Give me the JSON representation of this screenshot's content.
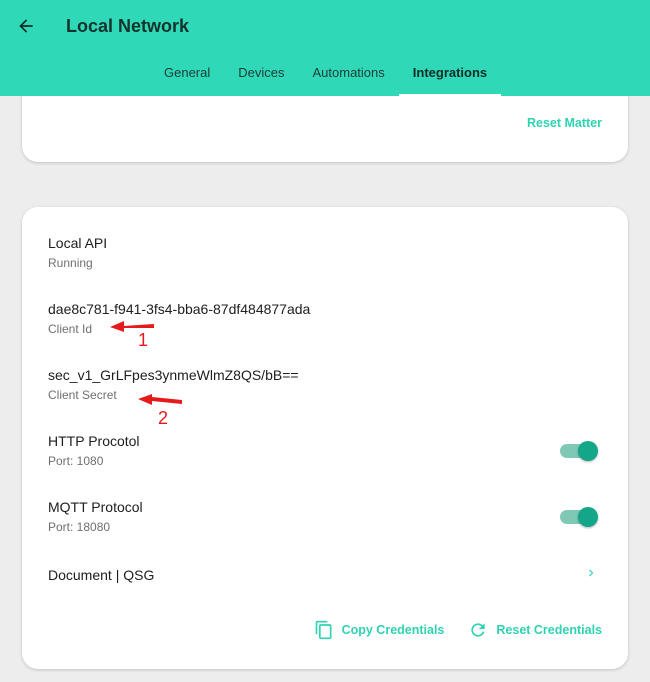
{
  "header": {
    "title": "Local Network",
    "tabs": [
      {
        "label": "General"
      },
      {
        "label": "Devices"
      },
      {
        "label": "Automations"
      },
      {
        "label": "Integrations"
      }
    ]
  },
  "matter_card": {
    "reset_label": "Reset Matter"
  },
  "local_api": {
    "title": "Local API",
    "status": "Running",
    "client_id": {
      "value": "dae8c781-f941-3fs4-bba6-87df484877ada",
      "label": "Client Id"
    },
    "client_secret": {
      "value": "sec_v1_GrLFpes3ynmeWlmZ8QS/bB==",
      "label": "Client Secret"
    },
    "http": {
      "title": "HTTP Procotol",
      "subtitle": "Port: 1080",
      "enabled": true
    },
    "mqtt": {
      "title": "MQTT Protocol",
      "subtitle": "Port: 18080",
      "enabled": true
    },
    "document": {
      "label": "Document | QSG"
    },
    "copy_label": "Copy Credentials",
    "reset_label": "Reset Credentials"
  },
  "annotations": [
    "1",
    "2"
  ],
  "colors": {
    "header_bg": "#2fd9b8",
    "accent": "#2fd3b2",
    "toggle_on": "#13a689",
    "annotation": "#e51b1b"
  },
  "icons": {
    "back": "arrow-left-icon",
    "copy": "copy-icon",
    "reset": "refresh-icon",
    "chevron": "chevron-right-icon"
  }
}
